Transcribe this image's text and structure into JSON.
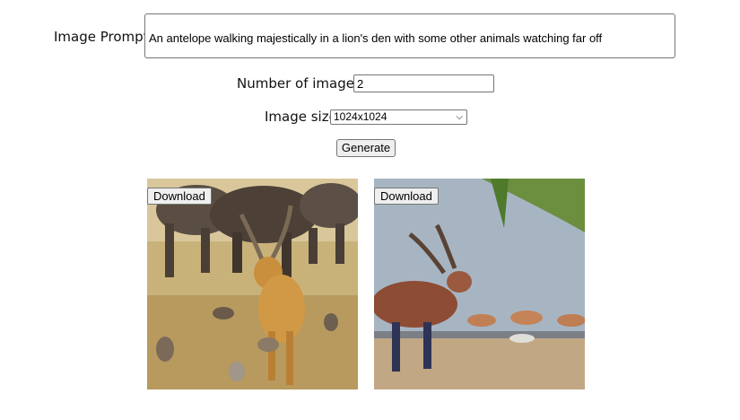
{
  "form": {
    "prompt_label": "Image Prompt:",
    "prompt_value": "An antelope walking majestically in a lion's den with some other animals watching far off",
    "num_label": "Number of images:",
    "num_value": "2",
    "size_label": "Image size:",
    "size_value": "1024x1024",
    "generate_label": "Generate"
  },
  "results": [
    {
      "download_label": "Download",
      "image_icon": "antelope-savanna-image"
    },
    {
      "download_label": "Download",
      "image_icon": "antelope-den-image"
    }
  ]
}
